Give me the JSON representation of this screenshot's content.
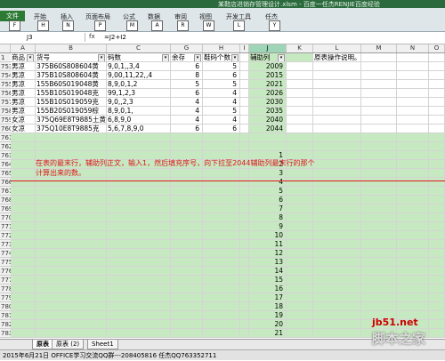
{
  "window": {
    "title": "某鞋店进销存管理设计.xlsm - 百度一任杰RENJIE百度经验"
  },
  "ribbon": {
    "file": "文件",
    "tabs": [
      "开始",
      "插入",
      "页面布局",
      "公式",
      "数据",
      "审阅",
      "视图",
      "开发工具",
      "任杰"
    ],
    "keytips": [
      "F",
      "H",
      "N",
      "P",
      "M",
      "A",
      "R",
      "W",
      "L",
      "Y"
    ]
  },
  "formula_bar": {
    "name_box": "J3",
    "fx": "fx",
    "formula": "=J2+I2"
  },
  "columns": [
    "A",
    "B",
    "C",
    "G",
    "H",
    "I",
    "J",
    "K",
    "L",
    "M",
    "N",
    "O"
  ],
  "selected_column": "J",
  "row_numbers": [
    "1",
    "753",
    "754",
    "755",
    "756",
    "757",
    "758",
    "759",
    "760",
    "761",
    "762",
    "763",
    "764",
    "765",
    "766",
    "767",
    "768",
    "769",
    "770",
    "771",
    "772",
    "773",
    "774",
    "775",
    "776",
    "777",
    "778",
    "779",
    "780",
    "781",
    "782",
    "783"
  ],
  "header_row": [
    "商品",
    "货号",
    "码数",
    "余存",
    "鞋码个数",
    "辅助列",
    "",
    "原表操作说明。",
    "",
    ""
  ],
  "data_rows": [
    [
      "男凉",
      "375B60S808604黄",
      "9,0,1,,3,4",
      "6",
      "5",
      "2009"
    ],
    [
      "男凉",
      "375B10S808604黄",
      "9,00,11,22,,4",
      "8",
      "6",
      "2015"
    ],
    [
      "男凉",
      "155B60S019048黄",
      "8,9,0,1,2",
      "5",
      "5",
      "2021"
    ],
    [
      "男凉",
      "155B10S019048克",
      "99,1,2,3",
      "6",
      "4",
      "2026"
    ],
    [
      "男凉",
      "155B10S019059克",
      "9,0,,2,3",
      "4",
      "4",
      "2030"
    ],
    [
      "男凉",
      "155B20S019059棕",
      "8,9,0,1,",
      "4",
      "5",
      "2035"
    ],
    [
      "女凉",
      "375Q69E8T9885土黄",
      "6,8,9,0",
      "4",
      "4",
      "2040"
    ],
    [
      "女凉",
      "375Q10E8T9885克",
      "5,6,7,8,9,0",
      "6",
      "6",
      "2044"
    ]
  ],
  "j_values": [
    "1",
    "2",
    "3",
    "4",
    "5",
    "6",
    "7",
    "8",
    "9",
    "10",
    "11",
    "12",
    "13",
    "14",
    "15",
    "16",
    "17",
    "18",
    "19",
    "20",
    "21"
  ],
  "note": "在表的最末行，辅助列正文，输入1，然后填充序号，向下拉至2044辅助列最末行的那个计算出来的数。",
  "sheet_tabs": [
    "原表",
    "原表 (2)",
    "Sheet1"
  ],
  "status": "2015年6月21日   OFFICE学习交流QQ群---208405816  任杰QQ763352711",
  "watermark": {
    "line1": "jb51.net",
    "line2": "脚本之家"
  },
  "colors": {
    "accent_green": "#2d7a35",
    "cell_green": "#c7e9c1",
    "note_red": "#e0141e"
  }
}
